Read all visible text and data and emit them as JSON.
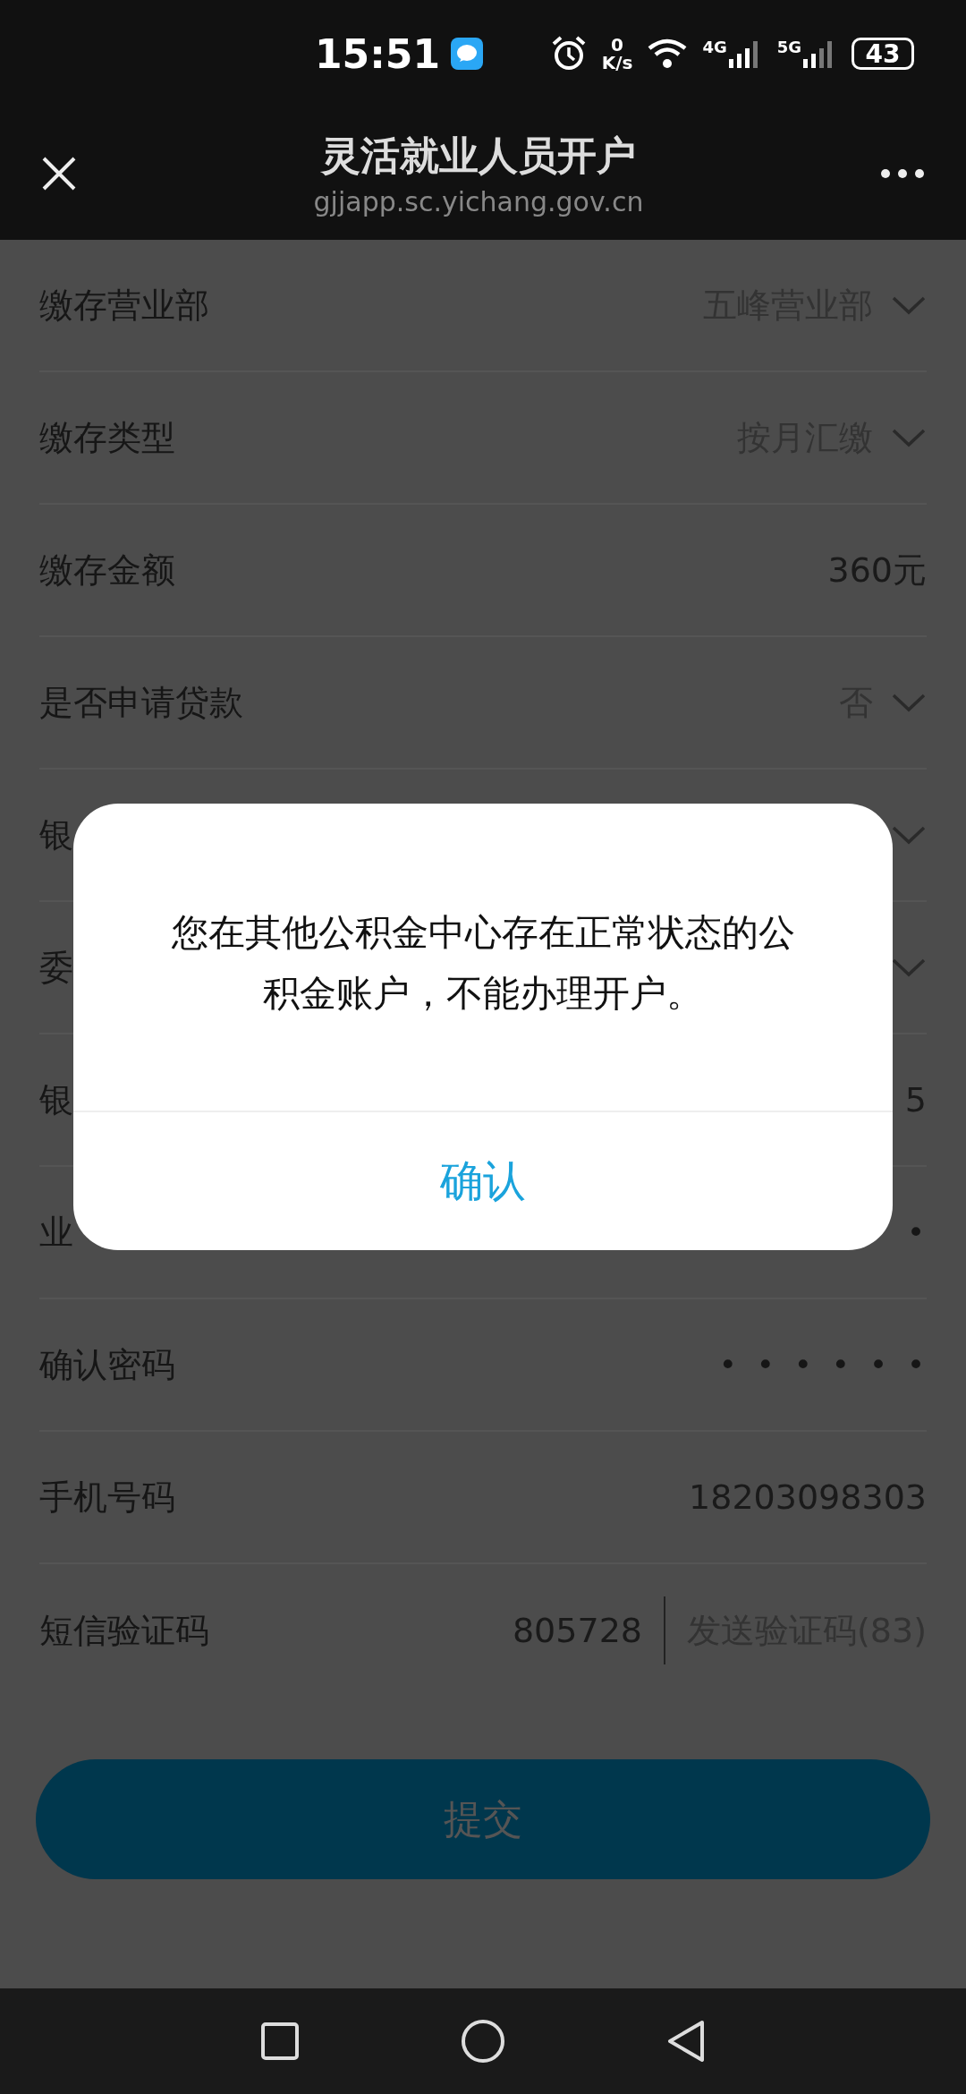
{
  "status_bar": {
    "time": "15:51",
    "net_speed_value": "0",
    "net_speed_unit": "K/s",
    "network_1": "4G",
    "network_2": "5G",
    "battery": "43"
  },
  "header": {
    "title": "灵活就业人员开户",
    "subtitle": "gjjapp.sc.yichang.gov.cn"
  },
  "form_rows": [
    {
      "kind": "select",
      "label": "缴存营业部",
      "value": "五峰营业部"
    },
    {
      "kind": "select",
      "label": "缴存类型",
      "value": "按月汇缴"
    },
    {
      "kind": "text",
      "label": "缴存金额",
      "value": "360元"
    },
    {
      "kind": "select",
      "label": "是否申请贷款",
      "value": "否"
    },
    {
      "kind": "select",
      "label": "银"
    },
    {
      "kind": "select",
      "label": "委"
    },
    {
      "kind": "text",
      "label": "银",
      "value": "5"
    },
    {
      "kind": "password",
      "label": "业",
      "value": "•"
    },
    {
      "kind": "password",
      "label": "确认密码",
      "value": "••••••"
    },
    {
      "kind": "text",
      "label": "手机号码",
      "value": "18203098303"
    },
    {
      "kind": "sms",
      "label": "短信验证码",
      "value": "805728",
      "action": "发送验证码(83)"
    }
  ],
  "submit_button": "提交",
  "dialog": {
    "message": "您在其他公积金中心存在正常状态的公积金账户，不能办理开户。",
    "confirm": "确认"
  }
}
